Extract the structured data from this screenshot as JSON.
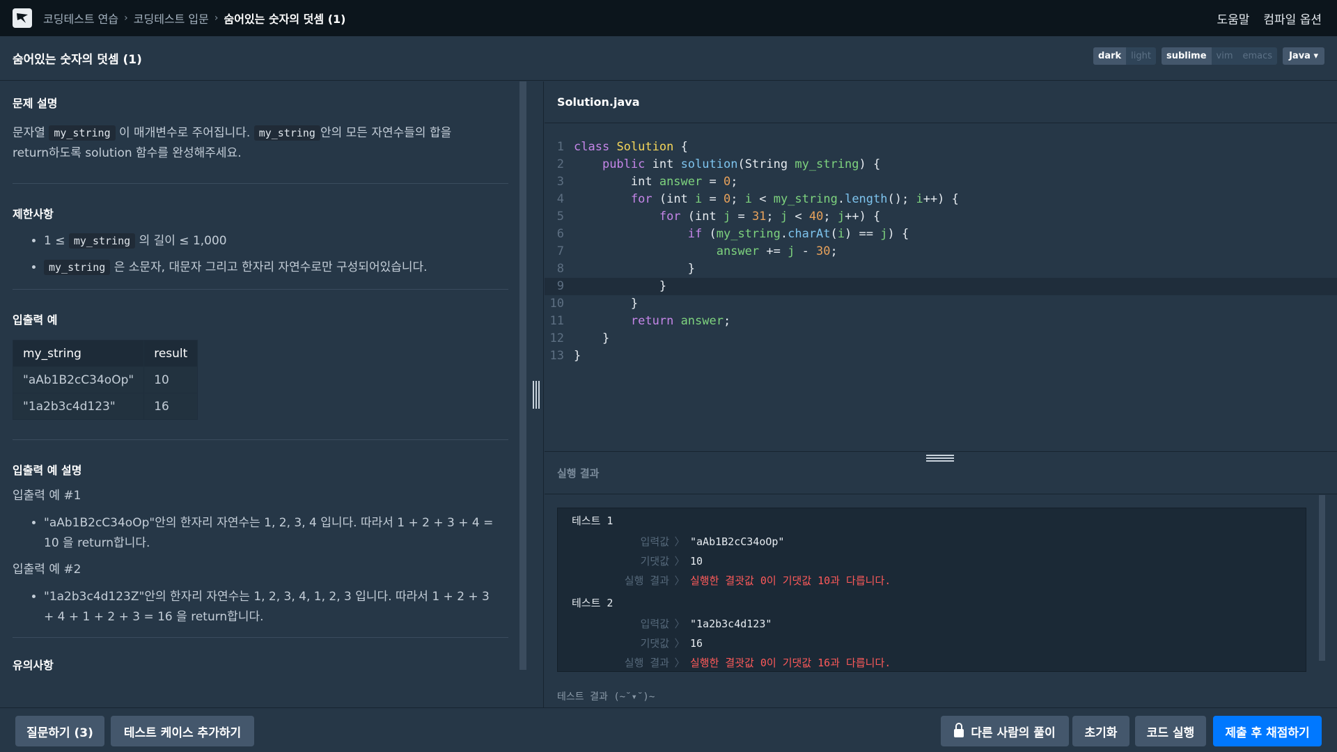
{
  "nav": {
    "crumbs": [
      "코딩테스트 연습",
      "코딩테스트 입문",
      "숨어있는 숫자의 덧셈 (1)"
    ],
    "separator": "›",
    "help": "도움말",
    "compile_options": "컴파일 옵션"
  },
  "title": "숨어있는 숫자의 덧셈 (1)",
  "settings": {
    "theme": [
      "dark",
      "light"
    ],
    "keymap": [
      "sublime",
      "vim",
      "emacs"
    ],
    "language": "Java"
  },
  "problem": {
    "desc_heading": "문제 설명",
    "desc_1": "문자열",
    "desc_code": "my_string",
    "desc_2": "이 매개변수로 주어집니다.",
    "desc_3": "안의 모든 자연수들의 합을",
    "desc_4": "return하도록 solution 함수를 완성해주세요.",
    "constraints_heading": "제한사항",
    "c1_pre": "1 ≤",
    "c1_post": "의 길이 ≤ 1,000",
    "c2_post": "은 소문자, 대문자 그리고 한자리 자연수로만 구성되어있습니다.",
    "io_heading": "입출력 예",
    "table_headers": [
      "my_string",
      "result"
    ],
    "table_rows": [
      [
        "\"aAb1B2cC34oOp\"",
        "10"
      ],
      [
        "\"1a2b3c4d123\"",
        "16"
      ]
    ],
    "io_desc_heading": "입출력 예 설명",
    "ex1_title": "입출력 예 #1",
    "ex1_text": "\"aAb1B2cC34oOp\"안의 한자리 자연수는 1, 2, 3, 4 입니다. 따라서 1 + 2 + 3 + 4 = 10 을 return합니다.",
    "ex2_title": "입출력 예 #2",
    "ex2_text": "\"1a2b3c4d123Z\"안의 한자리 자연수는 1, 2, 3, 4, 1, 2, 3 입니다. 따라서 1 + 2 + 3 + 4 + 1 + 2 + 3 = 16 을 return합니다.",
    "notes_heading": "유의사항"
  },
  "editor": {
    "filename": "Solution.java",
    "line_numbers": [
      "1",
      "2",
      "3",
      "4",
      "5",
      "6",
      "7",
      "8",
      "9",
      "10",
      "11",
      "12",
      "13"
    ]
  },
  "result": {
    "heading": "실행 결과",
    "labels": {
      "input": "입력값",
      "expected": "기댓값",
      "outcome": "실행 결과",
      "arrow": "〉"
    },
    "tests": [
      {
        "title": "테스트 1",
        "input": "\"aAb1B2cC34oOp\"",
        "expected": "10",
        "outcome": "실행한 결괏값 0이 기댓값 10과 다릅니다."
      },
      {
        "title": "테스트 2",
        "input": "\"1a2b3c4d123\"",
        "expected": "16",
        "outcome": "실행한 결괏값 0이 기댓값 16과 다릅니다."
      }
    ],
    "footer": "테스트 결과 (~˘▾˘)~"
  },
  "bottom": {
    "ask": "질문하기 (3)",
    "add_case": "테스트 케이스 추가하기",
    "others": "다른 사람의 풀이",
    "reset": "초기화",
    "run": "코드 실행",
    "submit": "제출 후 채점하기"
  },
  "colors": {
    "accent": "#0078ff",
    "error": "#ff5a5a",
    "background": "#263747"
  }
}
